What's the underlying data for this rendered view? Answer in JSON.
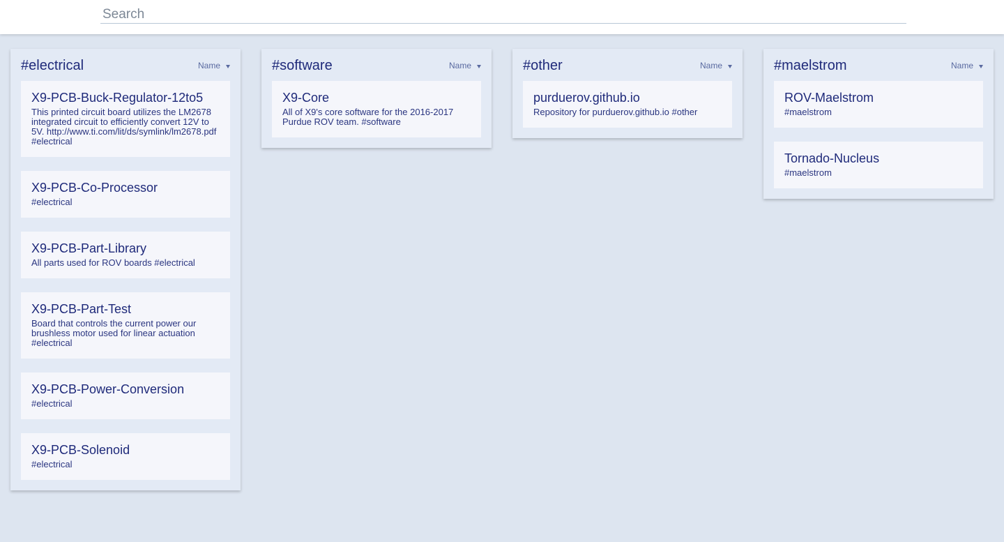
{
  "search": {
    "placeholder": "Search"
  },
  "columns": [
    {
      "title": "#electrical",
      "sort_label": "Name",
      "cards": [
        {
          "title": "X9-PCB-Buck-Regulator-12to5",
          "description": "This printed circuit board utilizes the LM2678 integrated circuit to efficiently convert 12V to 5V. http://www.ti.com/lit/ds/symlink/lm2678.pdf #electrical"
        },
        {
          "title": "X9-PCB-Co-Processor",
          "description": "#electrical"
        },
        {
          "title": "X9-PCB-Part-Library",
          "description": "All parts used for ROV boards #electrical"
        },
        {
          "title": "X9-PCB-Part-Test",
          "description": "Board that controls the current power our brushless motor used for linear actuation #electrical"
        },
        {
          "title": "X9-PCB-Power-Conversion",
          "description": "#electrical"
        },
        {
          "title": "X9-PCB-Solenoid",
          "description": "#electrical"
        }
      ]
    },
    {
      "title": "#software",
      "sort_label": "Name",
      "cards": [
        {
          "title": "X9-Core",
          "description": "All of X9's core software for the 2016-2017 Purdue ROV team. #software"
        }
      ]
    },
    {
      "title": "#other",
      "sort_label": "Name",
      "cards": [
        {
          "title": "purduerov.github.io",
          "description": "Repository for purduerov.github.io #other"
        }
      ]
    },
    {
      "title": "#maelstrom",
      "sort_label": "Name",
      "cards": [
        {
          "title": "ROV-Maelstrom",
          "description": "#maelstrom"
        },
        {
          "title": "Tornado-Nucleus",
          "description": "#maelstrom"
        }
      ]
    }
  ],
  "icons": {
    "sort": "caret-down-icon"
  },
  "colors": {
    "background": "#dde5f0",
    "column": "#e3eaf5",
    "card": "#f5f6fb",
    "text": "#1f2a7a"
  }
}
